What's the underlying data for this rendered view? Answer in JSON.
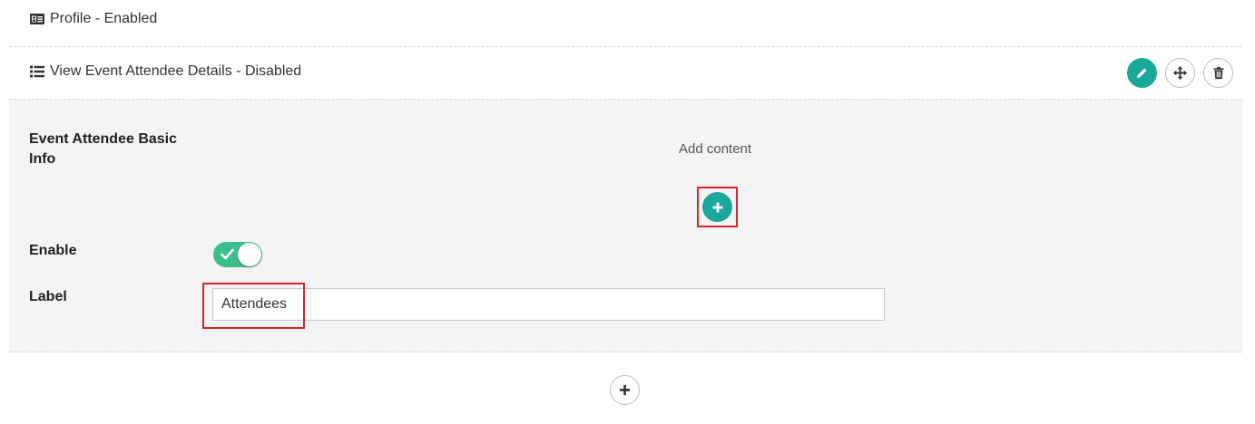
{
  "rows": {
    "profile": {
      "title": "Profile - Enabled",
      "icon": "id-card-icon"
    },
    "view_event": {
      "title": "View Event Attendee Details - Disabled",
      "icon": "list-icon"
    }
  },
  "actions": {
    "edit_icon": "pencil-icon",
    "move_icon": "move-arrows-icon",
    "delete_icon": "trash-icon"
  },
  "panel": {
    "section_label": "Event Attendee Basic Info",
    "add_content": "Add content",
    "enable_label": "Enable",
    "enable_value": true,
    "label_label": "Label",
    "label_value": "Attendees"
  },
  "colors": {
    "accent": "#19a89a",
    "toggle_on": "#3cbf8a",
    "highlight": "#d9242b",
    "panel_bg": "#f4f4f4"
  }
}
